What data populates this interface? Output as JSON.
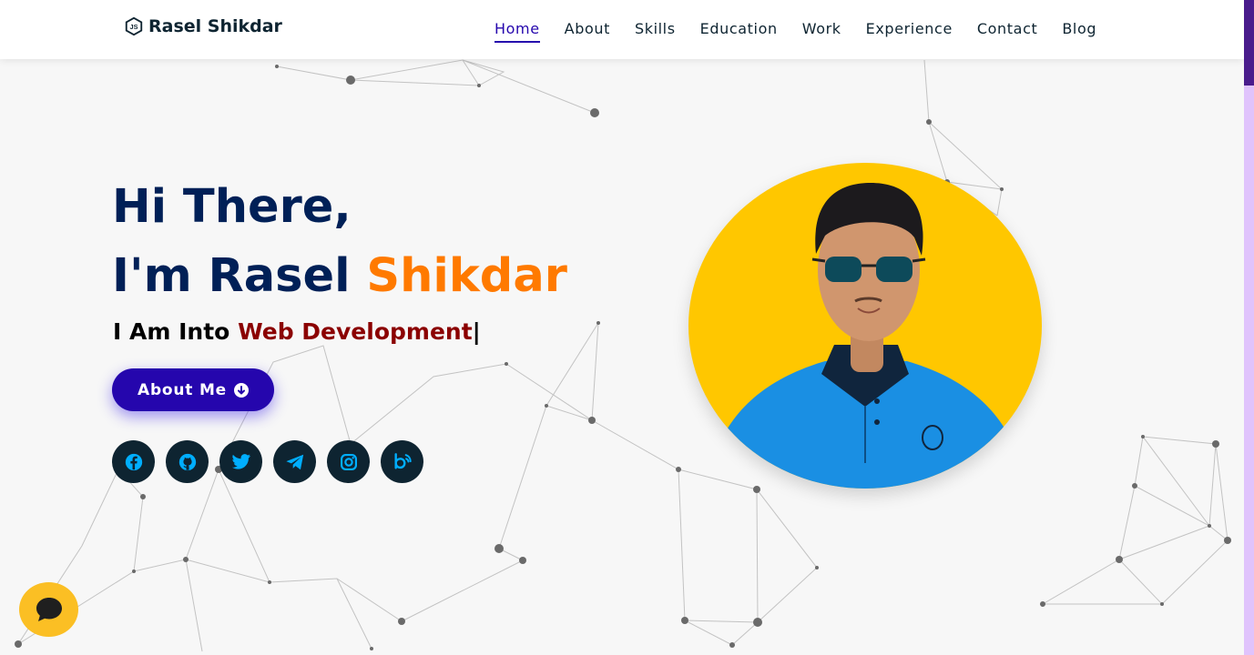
{
  "brand": {
    "name": "Rasel Shikdar",
    "icon": "node-js-icon"
  },
  "nav": {
    "items": [
      {
        "label": "Home",
        "active": true
      },
      {
        "label": "About"
      },
      {
        "label": "Skills"
      },
      {
        "label": "Education"
      },
      {
        "label": "Work"
      },
      {
        "label": "Experience"
      },
      {
        "label": "Contact"
      },
      {
        "label": "Blog"
      }
    ]
  },
  "hero": {
    "greeting": "Hi There,",
    "intro": "I'm Rasel",
    "last_name": "Shikdar",
    "subtitle_prefix": "I Am Into",
    "typed_text": "Web Development",
    "cursor": "|",
    "button_label": "About Me",
    "button_icon": "arrow-circle-down-icon"
  },
  "socials": [
    {
      "name": "facebook-icon"
    },
    {
      "name": "github-icon"
    },
    {
      "name": "twitter-icon"
    },
    {
      "name": "telegram-icon"
    },
    {
      "name": "instagram-icon"
    },
    {
      "name": "blog-icon"
    }
  ],
  "colors": {
    "primary": "#2506ad",
    "heading": "#002057",
    "accent": "#ff7a00",
    "typed": "#8b0000",
    "social_bg": "#0e2431",
    "social_icon": "#00aeff",
    "avatar_bg": "#ffc700",
    "chat_bg": "#fbbf24"
  },
  "chat": {
    "icon": "chat-bubble-icon"
  }
}
